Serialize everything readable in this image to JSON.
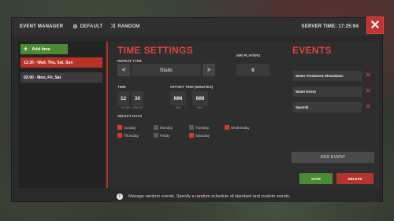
{
  "window": {
    "title": "EVENT MANAGER",
    "default_label": "DEFAULT",
    "random_label": "RANDOM",
    "server_time": "SERVER TIME: 17:25:94",
    "close_icon": "close-icon"
  },
  "sidebar": {
    "add_time_label": "Add time",
    "entries": [
      {
        "label": "12:30 - Wed, Thu, Sat, Sun",
        "active": true
      },
      {
        "label": "02:00 - Mon, Fri, Sat",
        "active": false
      }
    ]
  },
  "time_settings": {
    "heading": "TIME SETTINGS",
    "repeat_type_label": "REPEAT TYPE",
    "repeat_type_value": "Static",
    "prev_arrow": "<",
    "next_arrow": ">",
    "min_players_label": "MIN PLAYERS",
    "min_players_value": "0",
    "time_label": "TIME",
    "hours_value": "12",
    "minutes_value": "30",
    "hours_sub": "HOURS",
    "minutes_sub": "MINUTE",
    "offset_label": "OFFSET TIME (MINUTES)",
    "offset_min_value": "MM",
    "offset_max_value": "MM",
    "offset_min_sub": "MIN",
    "offset_max_sub": "MAX",
    "select_days_label": "SELECT DAYS",
    "days": [
      {
        "name": "Sunday",
        "checked": true
      },
      {
        "name": "Monday",
        "checked": false
      },
      {
        "name": "Tuesday",
        "checked": false
      },
      {
        "name": "Wednesday",
        "checked": true
      },
      {
        "name": "Thursday",
        "checked": true
      },
      {
        "name": "Friday",
        "checked": false
      },
      {
        "name": "Saturday",
        "checked": true
      }
    ]
  },
  "events": {
    "heading": "EVENTS",
    "items": [
      {
        "name": "Water-Treatment-Showdown"
      },
      {
        "name": "Water Event"
      },
      {
        "name": "Sputnik"
      }
    ],
    "add_event_label": "ADD EVENT",
    "save_label": "SAVE",
    "delete_label": "DELETE"
  },
  "info": {
    "icon": "info-icon",
    "text": "Manage random events. Specify a random schedule of standard and custom events."
  },
  "colors": {
    "accent_red": "#b5342a",
    "accent_green": "#4a8a32",
    "panel": "#2e2e2e"
  }
}
